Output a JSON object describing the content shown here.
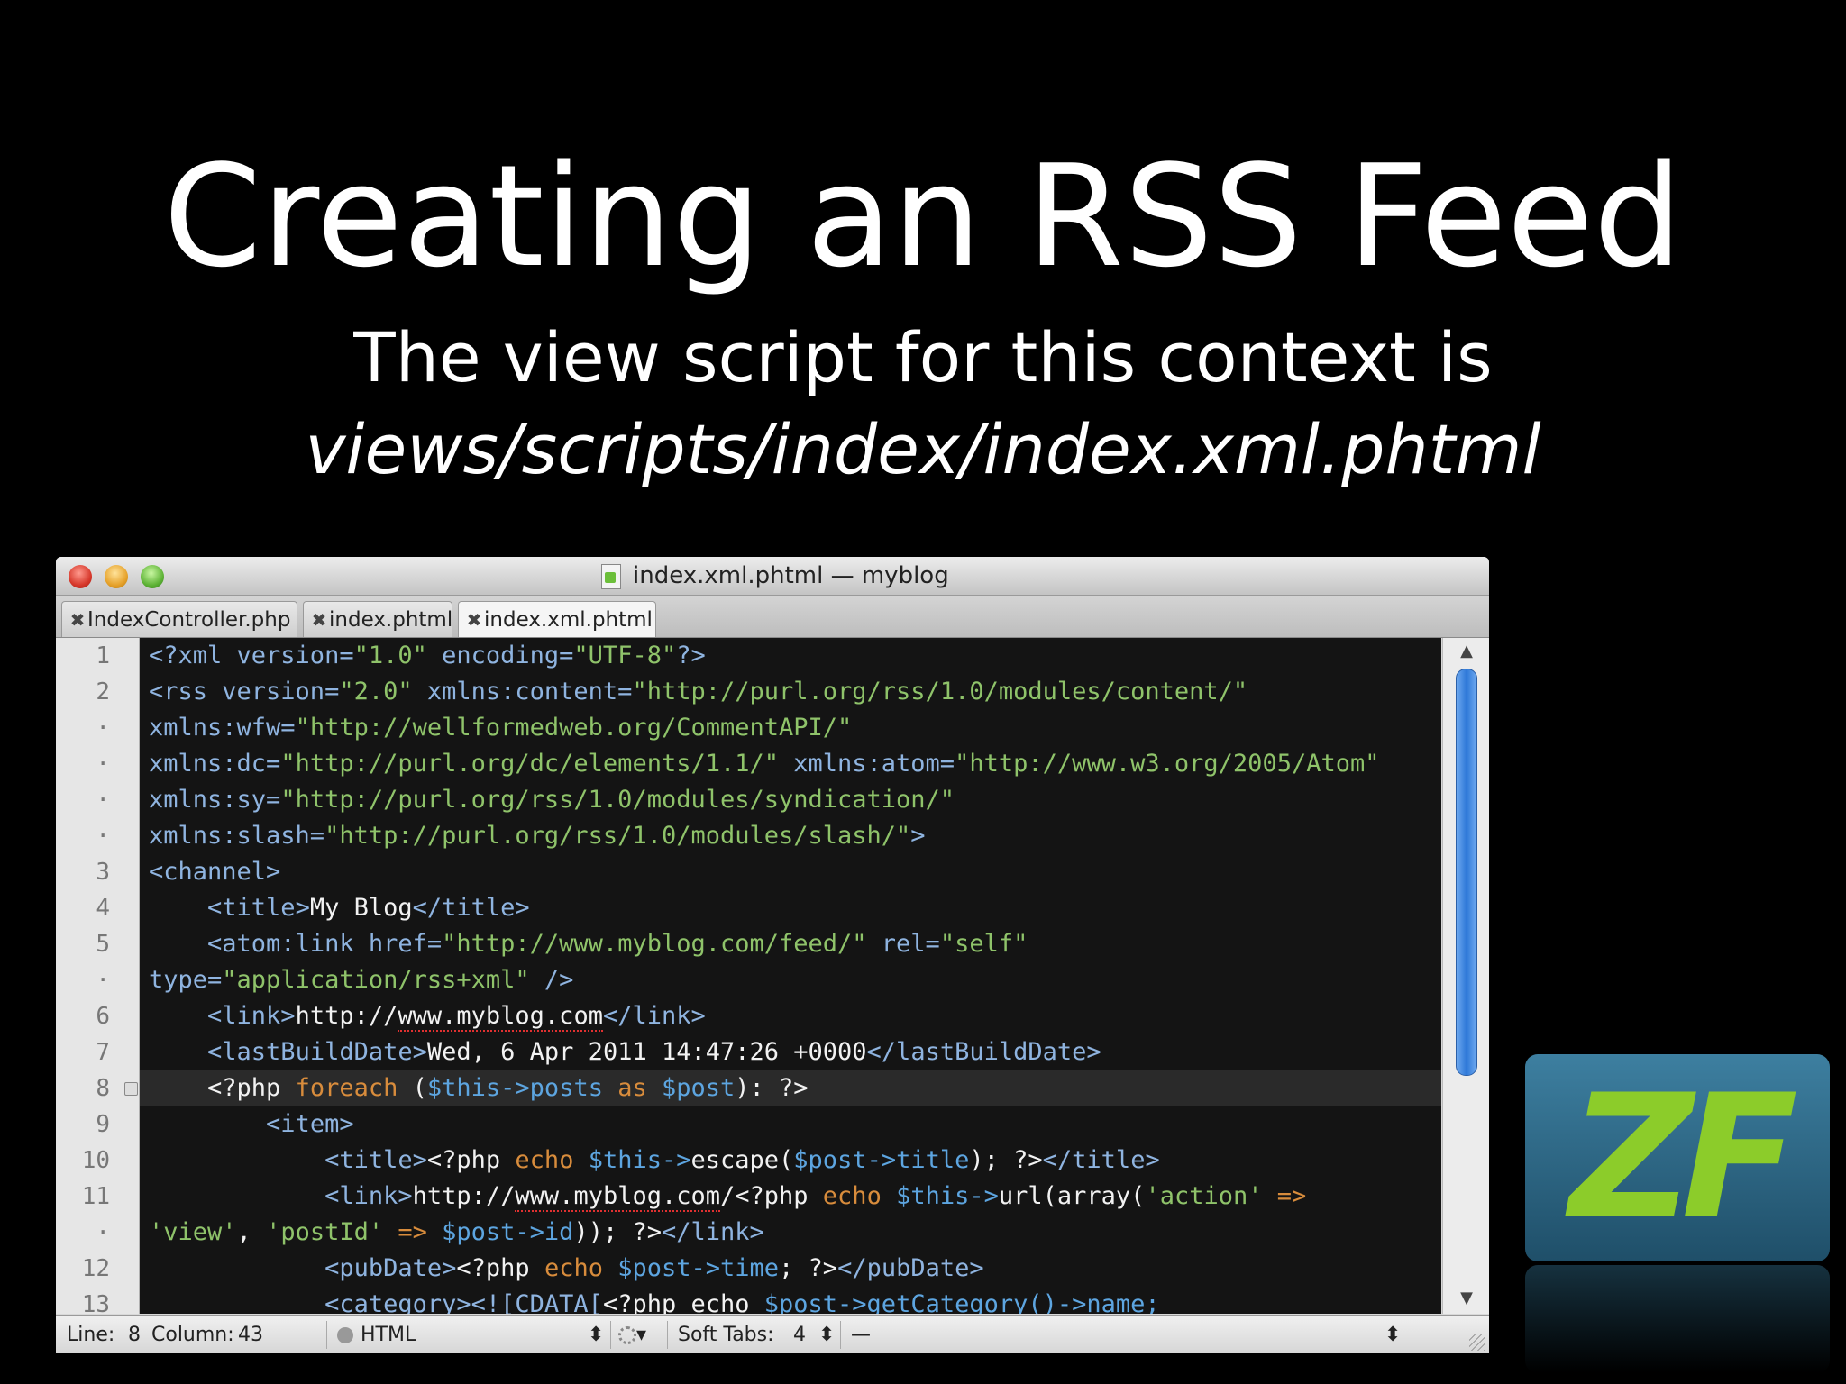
{
  "slide": {
    "title": "Creating an RSS Feed",
    "subtitle_line1": "The view script for this context is",
    "subtitle_line2": "views/scripts/index/index.xml.phtml"
  },
  "window": {
    "title": "index.xml.phtml — myblog",
    "tabs": [
      {
        "label": "IndexController.php",
        "close": "✖"
      },
      {
        "label": "index.phtml",
        "close": "✖"
      },
      {
        "label": "index.xml.phtml",
        "close": "✖"
      }
    ]
  },
  "gutter": [
    "1",
    "2",
    "·",
    "·",
    "·",
    "·",
    "3",
    "4",
    "5",
    "·",
    "6",
    "7",
    "8",
    "9",
    "10",
    "11",
    "·",
    "12",
    "13"
  ],
  "code": {
    "l1": {
      "a": "<?xml version=",
      "b": "\"1.0\"",
      "c": " encoding=",
      "d": "\"UTF-8\"",
      "e": "?>"
    },
    "l2": {
      "a": "<rss version=",
      "b": "\"2.0\"",
      "c": " xmlns:content=",
      "d": "\"http://purl.org/rss/1.0/modules/content/\""
    },
    "l3": {
      "a": "xmlns:wfw=",
      "b": "\"http://wellformedweb.org/CommentAPI/\""
    },
    "l4": {
      "a": "xmlns:dc=",
      "b": "\"http://purl.org/dc/elements/1.1/\"",
      "c": " xmlns:atom=",
      "d": "\"http://www.w3.org/2005/Atom\""
    },
    "l5": {
      "a": "xmlns:sy=",
      "b": "\"http://purl.org/rss/1.0/modules/syndication/\""
    },
    "l6": {
      "a": "xmlns:slash=",
      "b": "\"http://purl.org/rss/1.0/modules/slash/\"",
      "c": ">"
    },
    "l7": {
      "a": "<channel>"
    },
    "l8": {
      "indent": "    ",
      "a": "<title>",
      "b": "My Blog",
      "c": "</title>"
    },
    "l9": {
      "indent": "    ",
      "a": "<atom:link href=",
      "b": "\"http://www.myblog.com/feed/\"",
      "c": " rel=",
      "d": "\"self\""
    },
    "l10": {
      "a": "type=",
      "b": "\"application/rss+xml\"",
      "c": " />"
    },
    "l11": {
      "indent": "    ",
      "a": "<link>",
      "b1": "http://",
      "b2": "www.myblog.com",
      "c": "</link>"
    },
    "l12": {
      "indent": "    ",
      "a": "<lastBuildDate>",
      "b": "Wed, 6 Apr 2011 14:47:26 +0000",
      "c": "</lastBuildDate>"
    },
    "l13": {
      "indent": "    ",
      "a": "<?php ",
      "b": "foreach",
      "c": " (",
      "d": "$this->posts",
      "e": " as ",
      "f": "$post",
      "g": "): ?>"
    },
    "l14": {
      "indent": "        ",
      "a": "<item>"
    },
    "l15": {
      "indent": "            ",
      "a": "<title>",
      "b": "<?php ",
      "c": "echo ",
      "d": "$this->",
      "e": "escape(",
      "f": "$post->title",
      "g": "); ?>",
      "h": "</title>"
    },
    "l16": {
      "indent": "            ",
      "a": "<link>",
      "b1": "http://",
      "b2": "www.myblog.com",
      "b3": "/<?php ",
      "c": "echo ",
      "d": "$this->",
      "e": "url(array(",
      "f": "'action'",
      "g": " =>"
    },
    "l17": {
      "a": "'view'",
      "b": ", ",
      "c": "'postId'",
      "d": " => ",
      "e": "$post->id",
      "f": ")); ?>",
      "g": "</link>"
    },
    "l18": {
      "indent": "            ",
      "a": "<pubDate>",
      "b": "<?php ",
      "c": "echo ",
      "d": "$post->time",
      "e": "; ?>",
      "f": "</pubDate>"
    },
    "l19": {
      "indent": "            ",
      "a": "<category>",
      "b": "<![CDATA[",
      "c": "<?php echo ",
      "d": "$post->getCategory()->name;"
    }
  },
  "statusbar": {
    "line_label": "Line:",
    "line_value": "8",
    "column_label": "Column:",
    "column_value": "43",
    "language": "HTML",
    "stepper": "⬍",
    "gear_arrow": "▾",
    "soft_tabs_label": "Soft Tabs:",
    "soft_tabs_value": "4",
    "symbol": "—"
  },
  "scrollbar": {
    "up": "▲",
    "down": "▼"
  },
  "logo": {
    "text": "ZF"
  },
  "colors": {
    "tag": "#8fb4e0",
    "string": "#8fc36a",
    "keyword": "#d88c3c",
    "variable": "#5da5e0",
    "editor_bg": "#141414",
    "logo_green": "#8ccc2a"
  }
}
